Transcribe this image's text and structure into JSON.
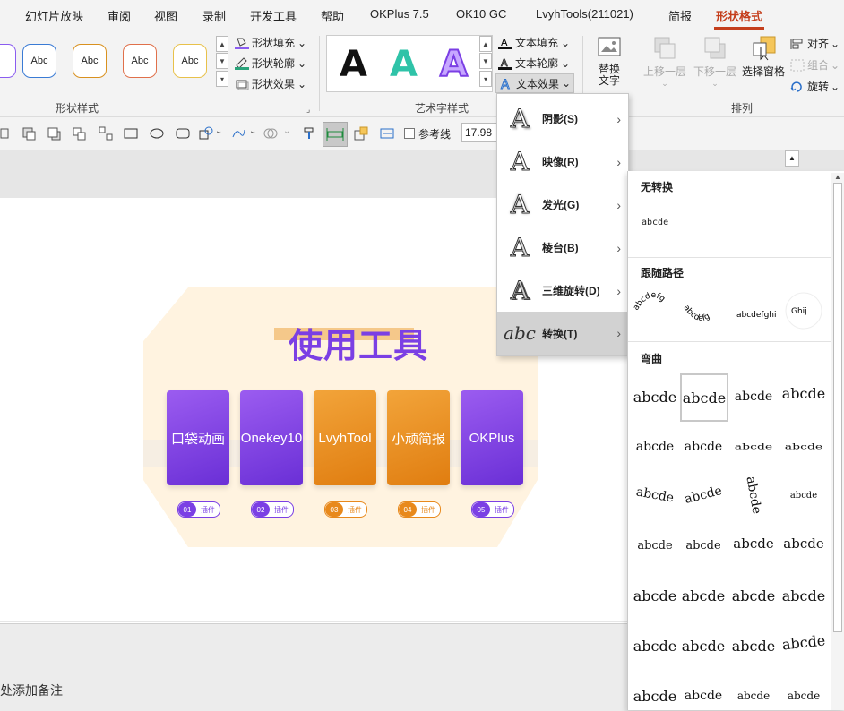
{
  "menu": {
    "items": [
      "幻灯片放映",
      "审阅",
      "视图",
      "录制",
      "开发工具",
      "帮助",
      "OKPlus 7.5",
      "OK10 GC",
      "LvyhTools(211021)",
      "简报",
      "形状格式"
    ],
    "active": "形状格式"
  },
  "ribbon": {
    "shape_style_samples": [
      "Abc",
      "Abc",
      "Abc",
      "Abc"
    ],
    "shape_fill": "形状填充",
    "shape_outline": "形状轮廓",
    "shape_effects": "形状效果",
    "shape_styles_label": "形状样式",
    "wordart_samples": [
      "A",
      "A",
      "A"
    ],
    "text_fill": "文本填充",
    "text_outline": "文本轮廓",
    "text_effects": "文本效果",
    "wordart_label": "艺术字样式",
    "alt_text": [
      "替换",
      "文字"
    ],
    "bring_forward": "上移一层",
    "send_backward": "下移一层",
    "selection_pane": "选择窗格",
    "align": "对齐",
    "group": "组合",
    "rotate": "旋转",
    "arrange_label": "排列"
  },
  "toolbar": {
    "guides_label": "参考线",
    "size_value": "17.98"
  },
  "text_effects_menu": [
    {
      "label": "阴影(S)",
      "icon": "shadow-a-icon"
    },
    {
      "label": "映像(R)",
      "icon": "reflection-a-icon"
    },
    {
      "label": "发光(G)",
      "icon": "glow-a-icon"
    },
    {
      "label": "棱台(B)",
      "icon": "bevel-a-icon"
    },
    {
      "label": "三维旋转(D)",
      "icon": "3d-rotation-a-icon"
    },
    {
      "label": "转换(T)",
      "icon": "transform-abc-icon"
    }
  ],
  "transform_gallery": {
    "no_transform_heading": "无转换",
    "no_transform_sample": "abcde",
    "follow_path_heading": "跟随路径",
    "warp_heading": "弯曲",
    "warp_sample": "abcde"
  },
  "slide": {
    "title": "使用工具",
    "cards": [
      {
        "label": "口袋动画",
        "color": "purple",
        "num": "01",
        "tag": "插件"
      },
      {
        "label": "Onekey10",
        "color": "purple",
        "num": "02",
        "tag": "插件"
      },
      {
        "label": "LvyhTool",
        "color": "orange",
        "num": "03",
        "tag": "插件"
      },
      {
        "label": "小顽简报",
        "color": "orange",
        "num": "04",
        "tag": "插件"
      },
      {
        "label": "OKPlus",
        "color": "purple",
        "num": "05",
        "tag": "插件"
      }
    ]
  },
  "notes_placeholder": "处添加备注",
  "colors": {
    "accent": "#c43e1c",
    "purple": "#7b3fe4",
    "orange": "#e8891c",
    "hexagon_bg": "#fff3e0"
  }
}
